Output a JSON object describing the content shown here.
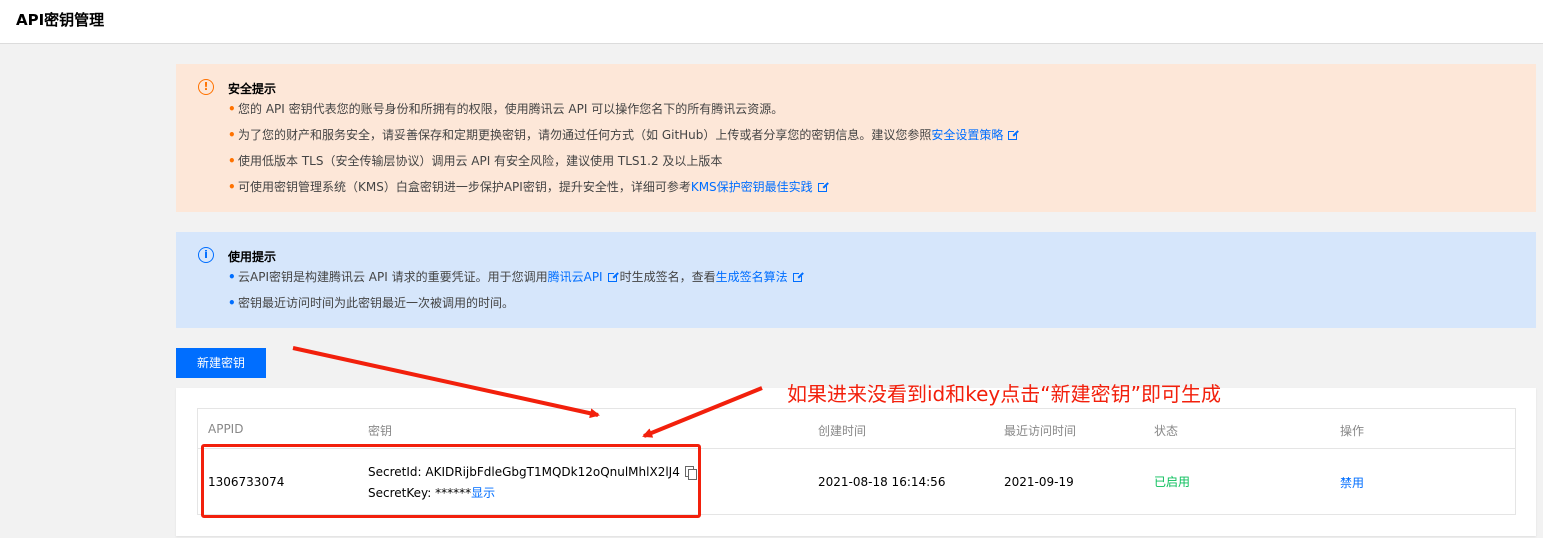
{
  "page": {
    "title": "API密钥管理"
  },
  "security_notice": {
    "title": "安全提示",
    "items": [
      {
        "text": "您的 API 密钥代表您的账号身份和所拥有的权限，使用腾讯云 API 可以操作您名下的所有腾讯云资源。"
      },
      {
        "text": "为了您的财产和服务安全，请妥善保存和定期更换密钥，请勿通过任何方式（如 GitHub）上传或者分享您的密钥信息。建议您参照",
        "link": "安全设置策略"
      },
      {
        "text": "使用低版本 TLS（安全传输层协议）调用云 API 有安全风险，建议使用 TLS1.2 及以上版本"
      },
      {
        "text": "可使用密钥管理系统（KMS）白盒密钥进一步保护API密钥，提升安全性，详细可参考",
        "link": "KMS保护密钥最佳实践"
      }
    ]
  },
  "usage_notice": {
    "title": "使用提示",
    "items": [
      {
        "prefix": "云API密钥是构建腾讯云 API 请求的重要凭证。用于您调用",
        "link1": "腾讯云API",
        "middle": "时生成签名，查看",
        "link2": "生成签名算法"
      },
      {
        "text": "密钥最近访问时间为此密钥最近一次被调用的时间。"
      }
    ]
  },
  "new_key_button": "新建密钥",
  "table": {
    "columns": [
      "APPID",
      "密钥",
      "创建时间",
      "最近访问时间",
      "状态",
      "操作"
    ],
    "rows": [
      {
        "appid": "1306733074",
        "secret_id_label": "SecretId: ",
        "secret_id": "AKIDRijbFdleGbgT1MQDk12oQnulMhlX2lJ4",
        "secret_key_label": "SecretKey: ",
        "secret_key": "******",
        "show_label": "显示",
        "created": "2021-08-18 16:14:56",
        "last_access": "2021-09-19",
        "status": "已启用",
        "action": "禁用"
      }
    ]
  },
  "annotation": {
    "text": "如果进来没看到id和key点击“新建密钥”即可生成",
    "color": "#f2200c"
  },
  "colors": {
    "accent": "#006eff",
    "warning": "#ff7200",
    "success": "#0abf5b"
  }
}
